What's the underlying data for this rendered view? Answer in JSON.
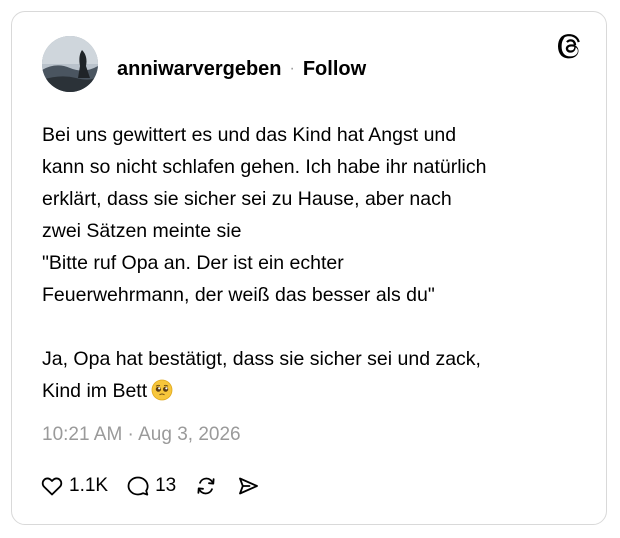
{
  "post": {
    "author": {
      "username": "anniwarvergeben",
      "separator": "·",
      "follow_label": "Follow",
      "avatar_icon": "avatar-photo"
    },
    "brand_icon": "threads-logo-icon",
    "text_lines": [
      "Bei uns gewittert es und das Kind hat Angst und",
      "kann so nicht schlafen gehen. Ich habe ihr natürlich",
      "erklärt, dass sie sicher sei zu Hause, aber nach",
      "zwei Sätzen meinte sie",
      "\"Bitte ruf Opa an. Der ist ein echter",
      "Feuerwehrmann, der weiß das besser als du\"",
      "",
      "Ja, Opa hat bestätigt, dass sie sicher sei und zack,",
      "Kind im Bett"
    ],
    "emoji": "pleading-face-emoji",
    "timestamp": "10:21 AM · Aug 3, 2026",
    "actions": {
      "likes": "1.1K",
      "replies": "13",
      "like_icon": "heart-icon",
      "reply_icon": "comment-icon",
      "repost_icon": "repost-icon",
      "share_icon": "share-icon"
    }
  }
}
